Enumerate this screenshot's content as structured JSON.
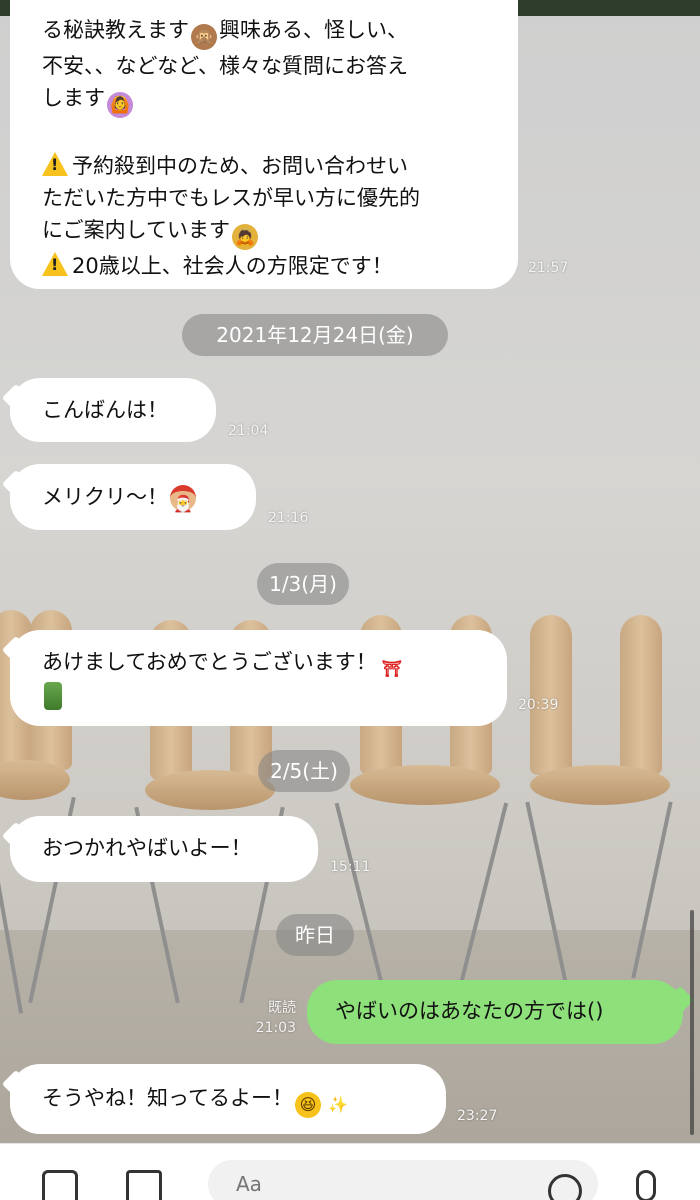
{
  "messages": {
    "m1": {
      "lines": [
        "る秘訣教えます",
        "興味ある、怪しい、",
        "不安、、などなど、様々な質問にお答え",
        "します",
        "予約殺到中のため、お問い合わせい",
        "ただいた方中でもレスが早い方に優先的",
        "にご案内しています",
        "20歳以上、社会人の方限定です！"
      ],
      "time": "21:57"
    },
    "date1": "2021年12月24日(金)",
    "m2": {
      "text": "こんばんは！",
      "time": "21:04"
    },
    "m3": {
      "text": "メリクリ〜！",
      "time": "21:16"
    },
    "date2": "1/3(月)",
    "m4": {
      "text": "あけましておめでとうございます！",
      "time": "20:39"
    },
    "date3": "2/5(土)",
    "m5": {
      "text": "おつかれやばいよー！",
      "time": "15:11"
    },
    "date4": "昨日",
    "m6": {
      "text": "やばいのはあなたの方では()",
      "read": "既読",
      "time": "21:03"
    },
    "m7": {
      "text": "そうやね！知ってるよー！",
      "time": "23:27"
    }
  },
  "input": {
    "placeholder": "Aa"
  },
  "icons": [
    "camera-icon",
    "image-icon",
    "emoji-icon",
    "microphone-icon"
  ],
  "colors": {
    "outgoing": "#8de07a",
    "incoming": "#ffffff",
    "topbar": "#2f3d2c"
  }
}
